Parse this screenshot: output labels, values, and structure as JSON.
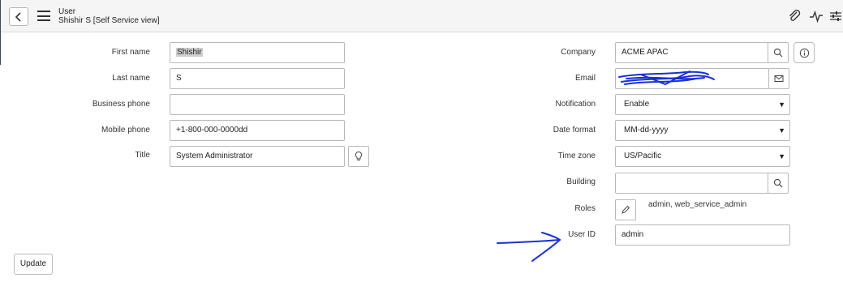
{
  "header": {
    "title": "User",
    "subtitle": "Shishir S [Self Service view]",
    "icons": [
      "chevron-left-icon",
      "menu-icon",
      "paperclip-icon",
      "activity-icon",
      "settings-sliders-icon"
    ]
  },
  "left_fields": {
    "first_name": {
      "label": "First name",
      "value": "Shishir"
    },
    "last_name": {
      "label": "Last name",
      "value": "S"
    },
    "business_phone": {
      "label": "Business phone",
      "value": ""
    },
    "mobile_phone": {
      "label": "Mobile phone",
      "value": "+1-800-000-0000dd"
    },
    "title": {
      "label": "Title",
      "value": "System Administrator"
    }
  },
  "right_fields": {
    "company": {
      "label": "Company",
      "value": "ACME APAC"
    },
    "email": {
      "label": "Email",
      "value": ""
    },
    "notification": {
      "label": "Notification",
      "value": "Enable"
    },
    "date_format": {
      "label": "Date format",
      "value": "MM-dd-yyyy"
    },
    "time_zone": {
      "label": "Time zone",
      "value": "US/Pacific"
    },
    "building": {
      "label": "Building",
      "value": ""
    },
    "roles": {
      "label": "Roles",
      "value": "admin, web_service_admin"
    },
    "user_id": {
      "label": "User ID",
      "value": "admin"
    }
  },
  "actions": {
    "update_label": "Update"
  },
  "colors": {
    "header_bg": "#f5f5f5",
    "annotation_blue": "#1a2fd6",
    "border": "#b9b9b9"
  }
}
